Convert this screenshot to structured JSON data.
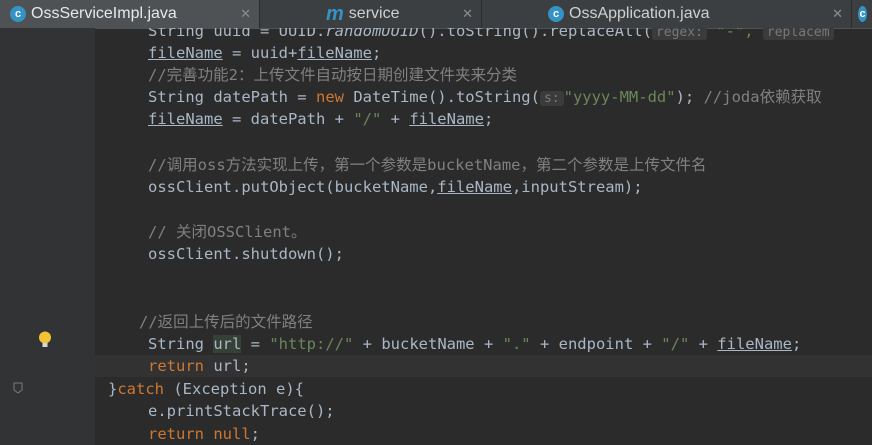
{
  "tabs": [
    {
      "label": "OssServiceImpl.java",
      "icon": "c",
      "active": true
    },
    {
      "label": "service",
      "icon": "m",
      "active": false
    },
    {
      "label": "OssApplication.java",
      "icon": "c",
      "active": false
    }
  ],
  "code": {
    "l0_a": "String uuid = UUID.",
    "l0_b": "randomUUID",
    "l0_c": "().toString().replaceAll(",
    "l0_hint": "regex:",
    "l0_d": " \"-\", ",
    "l0_hint2": "replacem",
    "l1_a": "fileName",
    "l1_b": " = uuid+",
    "l1_c": "fileName",
    "l1_d": ";",
    "l2": "//完善功能2：上传文件自动按日期创建文件夹来分类",
    "l3_a": "String datePath = ",
    "l3_new": "new",
    "l3_b": " DateTime().toString(",
    "l3_hint": "s:",
    "l3_str": "\"yyyy-MM-dd\"",
    "l3_c": "); ",
    "l3_cm": "//joda依赖获取",
    "l4_a": "fileName",
    "l4_b": " = datePath + ",
    "l4_str": "\"/\"",
    "l4_c": " + ",
    "l4_d": "fileName",
    "l4_e": ";",
    "l6": "//调用oss方法实现上传，第一个参数是bucketName，第二个参数是上传文件名",
    "l7_a": "ossClient.putObject(bucketName,",
    "l7_b": "fileName",
    "l7_c": ",inputStream);",
    "l9": "// 关闭OSSClient。",
    "l10": "ossClient.shutdown();",
    "l13": "//返回上传后的文件路径",
    "l14_a": "String ",
    "l14_url": "url",
    "l14_b": " = ",
    "l14_s1": "\"http://\"",
    "l14_c": " + bucketName + ",
    "l14_s2": "\".\"",
    "l14_d": " + endpoint + ",
    "l14_s3": "\"/\"",
    "l14_e": " + ",
    "l14_f": "fileName",
    "l14_g": ";",
    "l15_kw": "return",
    "l15_b": " url;",
    "l16_a": "}",
    "l16_kw": "catch",
    "l16_b": " (Exception e){",
    "l17": "e.printStackTrace();",
    "l18_kw": "return",
    "l18_null": "null",
    "l18_b": ";"
  },
  "colors": {
    "keyword": "#cc7832",
    "string": "#6a8759",
    "comment": "#808080",
    "text": "#a9b7c6",
    "background": "#2b2b2b"
  },
  "icons": {
    "gutter_bulb": "lightbulb-icon",
    "fold": "fold-marker-icon"
  }
}
